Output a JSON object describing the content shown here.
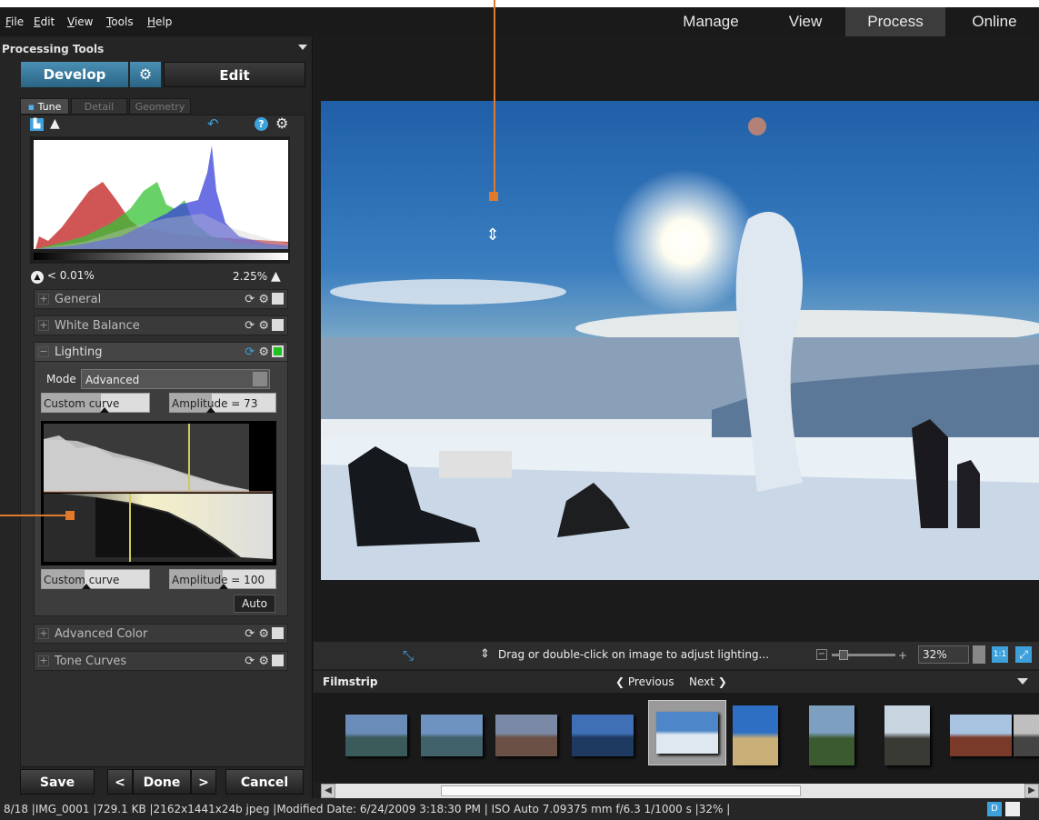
{
  "menu": {
    "items": [
      {
        "u": "F",
        "rest": "ile"
      },
      {
        "u": "E",
        "rest": "dit"
      },
      {
        "u": "V",
        "rest": "iew"
      },
      {
        "u": "T",
        "rest": "ools"
      },
      {
        "u": "H",
        "rest": "elp"
      }
    ]
  },
  "modes": {
    "manage": "Manage",
    "view": "View",
    "process": "Process",
    "online": "Online"
  },
  "panel": {
    "header": "Processing Tools",
    "develop": "Develop",
    "edit": "Edit",
    "tabs": {
      "tune": "Tune",
      "detail": "Detail",
      "geometry": "Geometry"
    },
    "clip_low": "< 0.01%",
    "clip_high": "2.25%",
    "sections": {
      "general": "General",
      "white_balance": "White Balance",
      "lighting": "Lighting",
      "advanced_color": "Advanced Color",
      "tone_curves": "Tone Curves"
    },
    "lighting": {
      "mode_label": "Mode",
      "mode_value": "Advanced",
      "curve_top": "Custom curve",
      "amp_top": "Amplitude = 73",
      "curve_bottom": "Custom curve",
      "amp_bottom": "Amplitude = 100",
      "auto": "Auto"
    },
    "buttons": {
      "save": "Save",
      "done": "Done",
      "cancel": "Cancel",
      "prev": "<",
      "next": ">"
    }
  },
  "viewer": {
    "hint": "Drag or double-click on image to adjust lighting...",
    "zoom": "32%",
    "one_to_one": "1:1"
  },
  "filmstrip": {
    "title": "Filmstrip",
    "previous": "Previous",
    "next": "Next",
    "thumbnail_count": 10,
    "selected_index": 4
  },
  "status": {
    "position": "8/18",
    "filename": "IMG_0001",
    "size": "729.1 KB",
    "dimensions": "2162x1441x24b jpeg",
    "modified": "Modified Date: 6/24/2009 3:18:30 PM",
    "iso": "ISO Auto",
    "focal": "7.09375 mm",
    "aperture": "f/6.3",
    "shutter": "1/1000 s",
    "zoom": "32%",
    "badge": "D"
  },
  "colors": {
    "accent": "#4a8fb4",
    "callout": "#e27a2c",
    "enabled_check": "#1ec21e"
  }
}
